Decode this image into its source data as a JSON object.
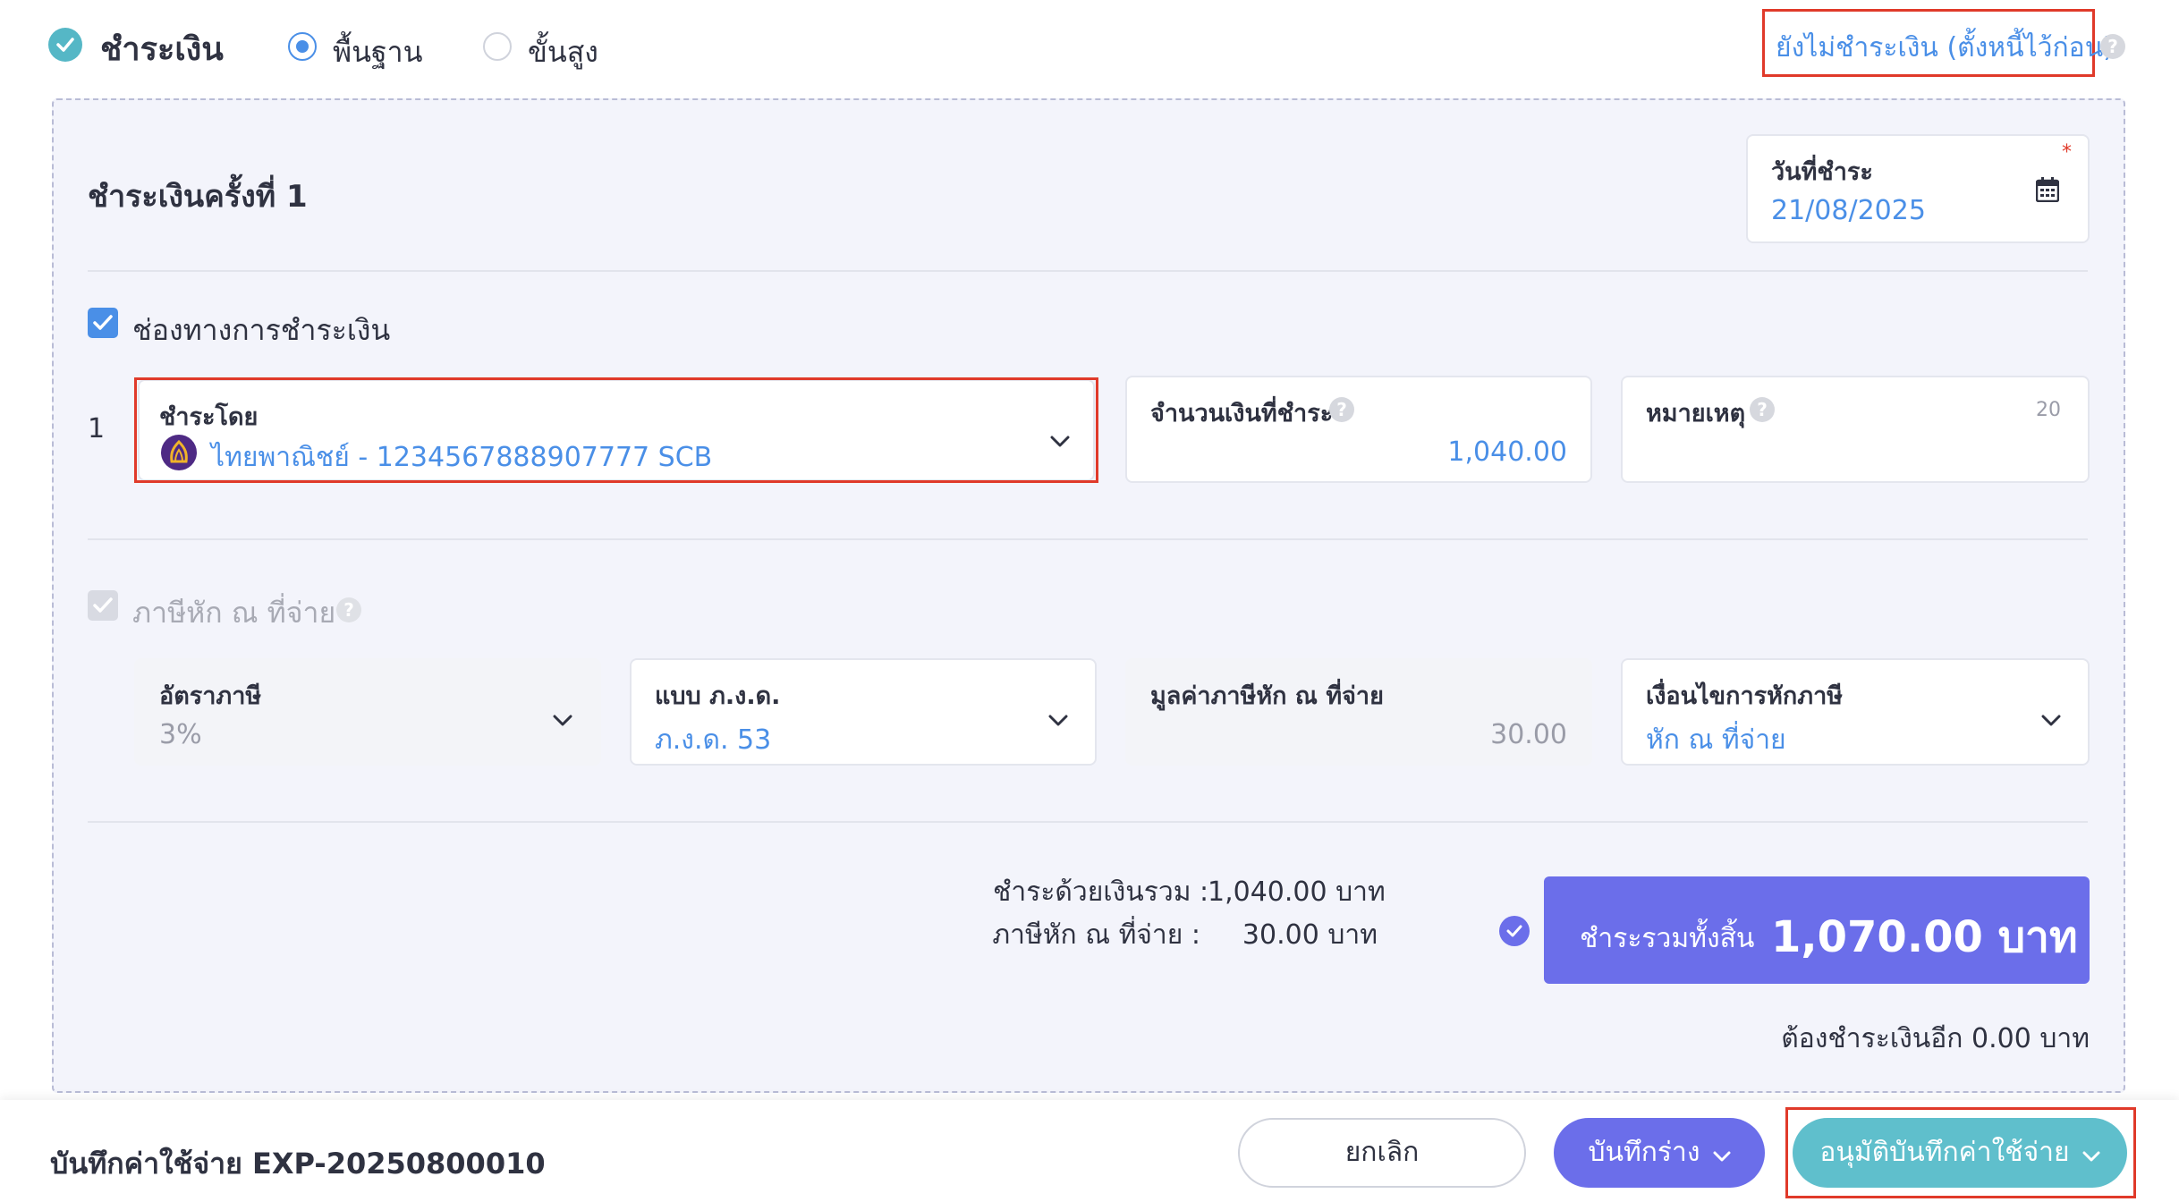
{
  "header": {
    "title": "ชำระเงิน",
    "mode_basic": "พื้นฐาน",
    "mode_advanced": "ขั้นสูง",
    "selected_mode": "พื้นฐาน",
    "unpaid_link": "ยังไม่ชำระเงิน (ตั้งหนี้ไว้ก่อน)"
  },
  "payment": {
    "section_title": "ชำระเงินครั้งที่ 1",
    "date_label": "วันที่ชำระ",
    "date_value": "21/08/2025",
    "channel_checkbox_label": "ช่องทางการชำระเงิน",
    "row_number": "1",
    "pay_by_label": "ชำระโดย",
    "pay_by_value": "ไทยพาณิชย์ - 1234567888907777 SCB",
    "amount_label": "จำนวนเงินที่ชำระ",
    "amount_value": "1,040.00",
    "note_label": "หมายเหตุ",
    "note_counter": "20"
  },
  "withholding": {
    "checkbox_label": "ภาษีหัก ณ ที่จ่าย",
    "rate_label": "อัตราภาษี",
    "rate_value": "3%",
    "form_label": "แบบ ภ.ง.ด.",
    "form_value": "ภ.ง.ด. 53",
    "tax_amount_label": "มูลค่าภาษีหัก ณ ที่จ่าย",
    "tax_amount_value": "30.00",
    "condition_label": "เงื่อนไขการหักภาษี",
    "condition_value": "หัก ณ ที่จ่าย"
  },
  "summary": {
    "cash_label": "ชำระด้วยเงินรวม :",
    "cash_value": "1,040.00 บาท",
    "wht_label": "ภาษีหัก ณ ที่จ่าย :",
    "wht_value": "30.00 บาท",
    "total_label": "ชำระรวมทั้งสิ้น",
    "total_value": "1,070.00 บาท",
    "remaining": "ต้องชำระเงินอีก 0.00 บาท"
  },
  "footer": {
    "title": "บันทึกค่าใช้จ่าย EXP-20250800010",
    "cancel_label": "ยกเลิก",
    "draft_label": "บันทึกร่าง",
    "approve_label": "อนุมัติบันทึกค่าใช้จ่าย"
  },
  "colors": {
    "accent_blue": "#4a8fe7",
    "primary_purple": "#6b6eea",
    "teal": "#5fbfcc",
    "highlight_red": "#e03a2a"
  },
  "icons": {
    "header_check": "check-circle-icon",
    "calendar": "calendar-icon",
    "bank_logo": "scb-bank-logo-icon",
    "help": "question-circle-icon",
    "dropdown": "chevron-down-icon"
  }
}
